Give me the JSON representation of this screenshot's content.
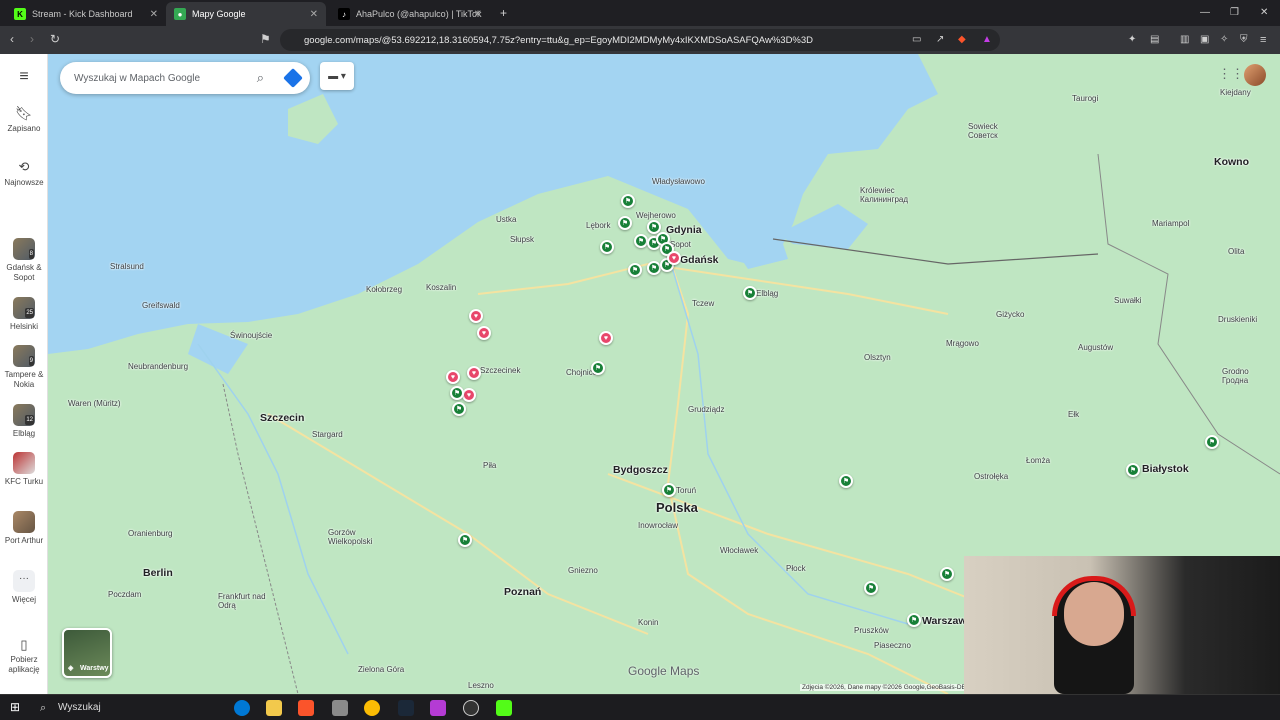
{
  "tabs": [
    {
      "title": "Stream - Kick Dashboard",
      "active": false
    },
    {
      "title": "Mapy Google",
      "active": true
    },
    {
      "title": "AhaPulco (@ahapulco) | TikTok",
      "active": false
    }
  ],
  "address": {
    "url": "google.com/maps/@53.692212,18.3160594,7.75z?entry=ttu&g_ep=EgoyMDI2MDMyMy4xIKXMDSoASAFQAw%3D%3D"
  },
  "search": {
    "placeholder": "Wyszukaj w Mapach Google"
  },
  "rail": {
    "menu_icon": "menu-icon",
    "saved_label": "Zapisano",
    "recent_label": "Najnowsze",
    "lists": [
      {
        "label": "Gdańsk & Sopot",
        "count": "8"
      },
      {
        "label": "Helsinki",
        "count": "25"
      },
      {
        "label": "Tampere & Nokia",
        "count": "9"
      },
      {
        "label": "Elbląg",
        "count": "12"
      },
      {
        "label": "KFC Turku",
        "count": ""
      },
      {
        "label": "Port Arthur",
        "count": ""
      }
    ],
    "more_label": "Więcej",
    "app_label": "Pobierz aplikację"
  },
  "layers": {
    "label": "Warstwy"
  },
  "places": {
    "gdansk": "Gdańsk",
    "gdynia": "Gdynia",
    "sopot": "Sopot",
    "wejherowo": "Wejherowo",
    "wladyslawowo": "Władysławowo",
    "lebork": "Lębork",
    "ustka": "Ustka",
    "slupsk": "Słupsk",
    "koszalin": "Koszalin",
    "kolobrzeg": "Kołobrzeg",
    "swinoujscie": "Świnoujście",
    "szczecin": "Szczecin",
    "stargard": "Stargard",
    "szczecinek": "Szczecinek",
    "chojnice": "Chojnice",
    "tczew": "Tczew",
    "elblag": "Elbląg",
    "olsztyn": "Olsztyn",
    "grudziadz": "Grudziądz",
    "bydgoszcz": "Bydgoszcz",
    "torun": "Toruń",
    "polska": "Polska",
    "inowroclaw": "Inowrocław",
    "wloclawek": "Włocławek",
    "plock": "Płock",
    "pila": "Piła",
    "gorzow": "Gorzów Wielkopolski",
    "poznan": "Poznań",
    "gniezno": "Gniezno",
    "konin": "Konin",
    "leszno": "Leszno",
    "zielona": "Zielona Góra",
    "berlin": "Berlin",
    "poczdam": "Poczdam",
    "frankfurt": "Frankfurt nad Odrą",
    "oranienburg": "Oranienburg",
    "neubrandenburg": "Neubrandenburg",
    "waren": "Waren (Müritz)",
    "greifswald": "Greifswald",
    "stralsund": "Stralsund",
    "krolewiec": "Królewiec Калининград",
    "sowieck": "Sowieck Советск",
    "taurogi": "Taurogi",
    "kiejdany": "Kiejdany",
    "kowno": "Kowno",
    "mariampol": "Mariampol",
    "olita": "Olita",
    "suwalki": "Suwałki",
    "druskieniki": "Druskieniki",
    "augustow": "Augustów",
    "grodno": "Grodno Гродна",
    "gizycko": "Giżycko",
    "mragowo": "Mrągowo",
    "elk": "Ełk",
    "lomza": "Łomża",
    "ostroleka": "Ostrołęka",
    "bialystok": "Białystok",
    "pruszkow": "Pruszków",
    "piaseczno": "Piaseczno",
    "warszawa": "Warszaw"
  },
  "map_footer": {
    "brand": "Google Maps",
    "attribution": "Zdjęcia ©2026, Dane mapy ©2026 Google,GeoBasis-DE"
  },
  "taskbar": {
    "search_label": "Wyszukaj"
  },
  "colors": {
    "sea": "#a3d4f2",
    "land": "#bfe6c2",
    "pin_green": "#188038",
    "pin_heart": "#e8476b"
  }
}
